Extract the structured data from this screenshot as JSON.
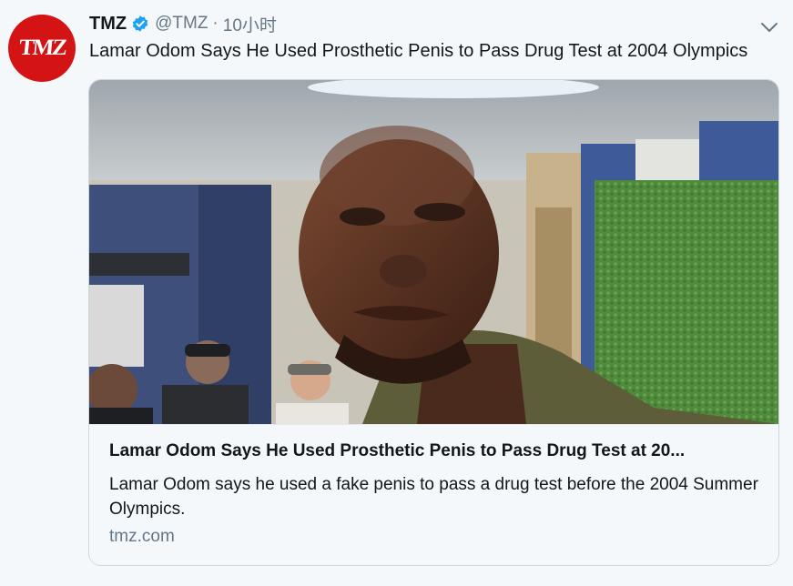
{
  "tweet": {
    "author_name": "TMZ",
    "handle": "@TMZ",
    "separator": "·",
    "timestamp": "10小时",
    "text": "Lamar Odom Says He Used Prosthetic Penis to Pass Drug Test at 2004 Olympics",
    "avatar_logo_text": "TMZ"
  },
  "card": {
    "title": "Lamar Odom Says He Used Prosthetic Penis to Pass Drug Test at 20...",
    "description": "Lamar Odom says he used a fake penis to pass a drug test before the 2004 Summer Olympics.",
    "domain": "tmz.com"
  },
  "colors": {
    "brand_red": "#d41414",
    "verified_blue": "#1da1f2",
    "text_primary": "#14171a",
    "text_secondary": "#657786",
    "card_border": "#ccd6dd"
  },
  "icons": {
    "verified": "verified-badge-icon",
    "more": "chevron-down-icon"
  }
}
